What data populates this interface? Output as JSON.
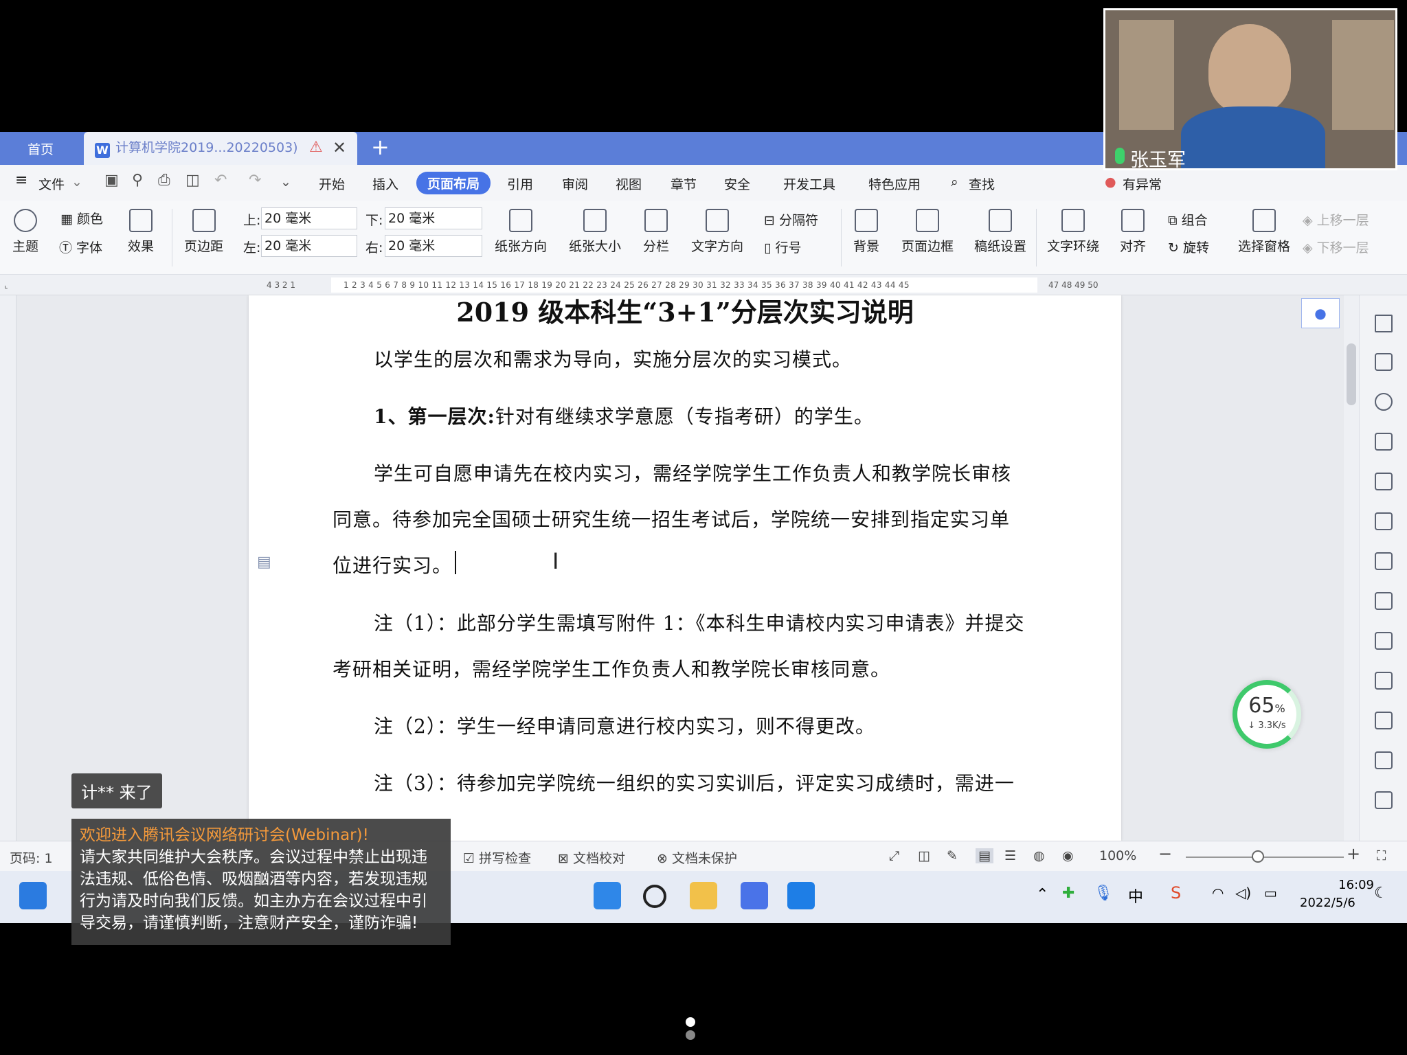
{
  "tabs": {
    "home": "首页",
    "doc_title": "计算机学院2019...20220503)"
  },
  "menu": {
    "file": "文件",
    "items": [
      "开始",
      "插入",
      "页面布局",
      "引用",
      "审阅",
      "视图",
      "章节",
      "安全",
      "开发工具",
      "特色应用"
    ],
    "search": "查找",
    "status": "有异常"
  },
  "ribbon": {
    "theme": "主题",
    "color": "颜色",
    "font": "字体",
    "effect": "效果",
    "margin": "页边距",
    "top_label": "上:",
    "top_value": "20 毫米",
    "bottom_label": "下:",
    "bottom_value": "20 毫米",
    "left_label": "左:",
    "left_value": "20 毫米",
    "right_label": "右:",
    "right_value": "20 毫米",
    "orientation": "纸张方向",
    "size": "纸张大小",
    "columns": "分栏",
    "text_direction": "文字方向",
    "breaks": "分隔符",
    "line_numbers": "行号",
    "background": "背景",
    "page_border": "页面边框",
    "manuscript": "稿纸设置",
    "wrap": "文字环绕",
    "align": "对齐",
    "group": "组合",
    "rotate": "旋转",
    "selection_pane": "选择窗格",
    "bring_forward": "上移一层",
    "send_backward": "下移一层"
  },
  "ruler": {
    "left_ticks": "4 3 2 1",
    "ticks": "1 2 3 4 5 6 7 8 9 10 11 12 13 14 15 16 17 18 19 20 21 22 23 24 25 26 27 28 29 30 31 32 33 34 35 36 37 38 39 40 41 42 43 44 45",
    "right_ticks": "47 48 49 50"
  },
  "document": {
    "title": "2019 级本科生“3+1”分层次实习说明",
    "p1": "以学生的层次和需求为导向，实施分层次的实习模式。",
    "p2_bold": "1、第一层次:",
    "p2_rest": "针对有继续求学意愿（专指考研）的学生。",
    "p3_l1": "学生可自愿申请先在校内实习，需经学院学生工作负责人和教学院长审核",
    "p3_l2": "同意。待参加完全国硕士研究生统一招生考试后，学院统一安排到指定实习单",
    "p3_l3": "位进行实习。",
    "p4_l1": "注（1）：此部分学生需填写附件 1：《本科生申请校内实习申请表》并提交",
    "p4_l2": "考研相关证明，需经学院学生工作负责人和教学院长审核同意。",
    "p5": "注（2）：学生一经申请同意进行校内实习，则不得更改。",
    "p6": "注（3）：待参加完学院统一组织的实习实训后，评定实习成绩时，需进一"
  },
  "network": {
    "percent": "65",
    "unit": "%",
    "speed": "3.3K/s"
  },
  "statusbar": {
    "page": "页码: 1",
    "spell": "拼写检查",
    "proof": "文档校对",
    "protect": "文档未保护",
    "zoom": "100%"
  },
  "taskbar": {
    "time": "16:09",
    "date": "2022/5/6",
    "ime": "中"
  },
  "meeting": {
    "speaker": "张玉军",
    "join": "计** 来了",
    "notice_title": "欢迎进入腾讯会议网络研讨会(Webinar)!",
    "notice_body": "请大家共同维护大会秩序。会议过程中禁止出现违法违规、低俗色情、吸烟酗酒等内容，若发现违规行为请及时向我们反馈。如主办方在会议过程中引导交易，请谨慎判断，注意财产安全，谨防诈骗!"
  },
  "colors": {
    "tab_bar": "#5b7ed8",
    "accent": "#4773e6",
    "gauge": "#3ec96b"
  }
}
